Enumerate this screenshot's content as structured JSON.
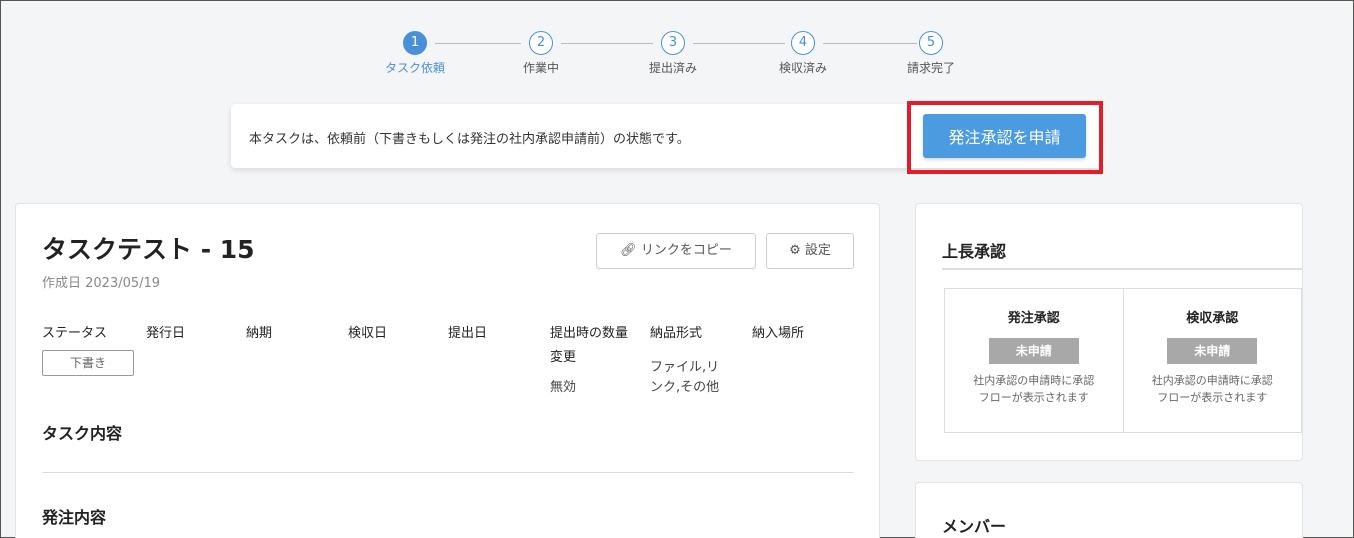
{
  "stepper": {
    "steps": [
      {
        "num": "1",
        "label": "タスク依頼"
      },
      {
        "num": "2",
        "label": "作業中"
      },
      {
        "num": "3",
        "label": "提出済み"
      },
      {
        "num": "4",
        "label": "検収済み"
      },
      {
        "num": "5",
        "label": "請求完了"
      }
    ],
    "active_step": 1,
    "accent": "#4a90d9"
  },
  "notice": {
    "text": "本タスクは、依頼前（下書きもしくは発注の社内承認申請前）の状態です。",
    "button_label": "発注承認を申請",
    "highlight_color": "#e21d2a"
  },
  "task": {
    "title": "タスクテスト - 15",
    "created": "作成日 2023/05/19",
    "copy_link_label": "リンクをコピー",
    "settings_label": "設定",
    "columns": {
      "status": "ステータス",
      "issue_date": "発行日",
      "deadline": "納期",
      "inspection_date": "検収日",
      "submit_date": "提出日",
      "qty_change_line1": "提出時の数量",
      "qty_change_line2": "変更",
      "delivery_format": "納品形式",
      "delivery_place": "納入場所"
    },
    "values": {
      "status_badge": "下書き",
      "qty_change": "無効",
      "delivery_format_line1": "ファイル,リ",
      "delivery_format_line2": "ンク,その他"
    },
    "section_task_content": "タスク内容",
    "section_order_content": "発注内容"
  },
  "approval": {
    "title": "上長承認",
    "items": [
      {
        "title": "発注承認",
        "badge": "未申請",
        "note_line1": "社内承認の申請時に承認",
        "note_line2": "フローが表示されます"
      },
      {
        "title": "検収承認",
        "badge": "未申請",
        "note_line1": "社内承認の申請時に承認",
        "note_line2": "フローが表示されます"
      }
    ]
  },
  "members": {
    "title": "メンバー"
  }
}
